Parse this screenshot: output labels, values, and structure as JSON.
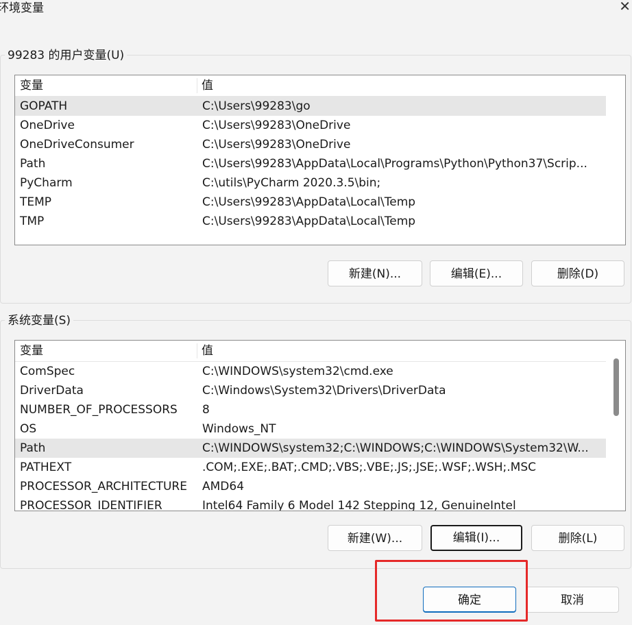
{
  "window": {
    "title": "环境变量",
    "close_glyph": "✕"
  },
  "user_vars": {
    "legend": "99283 的用户变量(U)",
    "columns": [
      "变量",
      "值"
    ],
    "rows": [
      {
        "name": "GOPATH",
        "value": "C:\\Users\\99283\\go",
        "selected": true
      },
      {
        "name": "OneDrive",
        "value": "C:\\Users\\99283\\OneDrive"
      },
      {
        "name": "OneDriveConsumer",
        "value": "C:\\Users\\99283\\OneDrive"
      },
      {
        "name": "Path",
        "value": "C:\\Users\\99283\\AppData\\Local\\Programs\\Python\\Python37\\Scrip..."
      },
      {
        "name": "PyCharm",
        "value": "C:\\utils\\PyCharm 2020.3.5\\bin;"
      },
      {
        "name": "TEMP",
        "value": "C:\\Users\\99283\\AppData\\Local\\Temp"
      },
      {
        "name": "TMP",
        "value": "C:\\Users\\99283\\AppData\\Local\\Temp"
      }
    ],
    "buttons": {
      "new": "新建(N)...",
      "edit": "编辑(E)...",
      "delete": "删除(D)"
    }
  },
  "system_vars": {
    "legend": "系统变量(S)",
    "columns": [
      "变量",
      "值"
    ],
    "rows": [
      {
        "name": "ComSpec",
        "value": "C:\\WINDOWS\\system32\\cmd.exe"
      },
      {
        "name": "DriverData",
        "value": "C:\\Windows\\System32\\Drivers\\DriverData"
      },
      {
        "name": "NUMBER_OF_PROCESSORS",
        "value": "8"
      },
      {
        "name": "OS",
        "value": "Windows_NT"
      },
      {
        "name": "Path",
        "value": "C:\\WINDOWS\\system32;C:\\WINDOWS;C:\\WINDOWS\\System32\\W...",
        "selected": true
      },
      {
        "name": "PATHEXT",
        "value": ".COM;.EXE;.BAT;.CMD;.VBS;.VBE;.JS;.JSE;.WSF;.WSH;.MSC"
      },
      {
        "name": "PROCESSOR_ARCHITECTURE",
        "value": "AMD64"
      },
      {
        "name": "PROCESSOR_IDENTIFIER",
        "value": "Intel64 Family 6 Model 142 Stepping 12, GenuineIntel"
      }
    ],
    "buttons": {
      "new": "新建(W)...",
      "edit": "编辑(I)...",
      "delete": "删除(L)"
    }
  },
  "dialog_buttons": {
    "ok": "确定",
    "cancel": "取消"
  },
  "colors": {
    "selection": "#e6e6e6",
    "highlight": "#e52929",
    "primary_border": "#0f6cbd"
  }
}
